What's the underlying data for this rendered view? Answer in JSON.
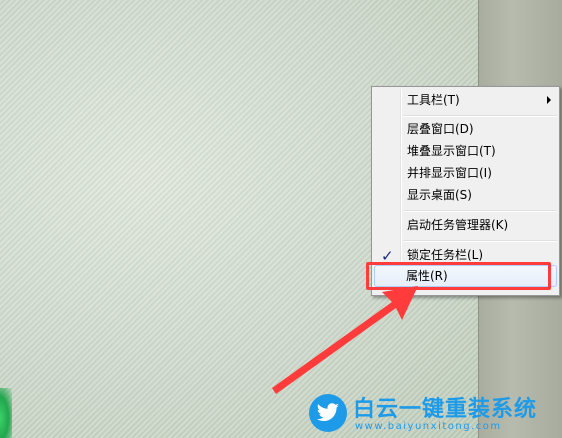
{
  "context_menu": {
    "items": [
      {
        "label": "工具栏(T)",
        "has_submenu": true
      },
      {
        "label": "层叠窗口(D)"
      },
      {
        "label": "堆叠显示窗口(T)"
      },
      {
        "label": "并排显示窗口(I)"
      },
      {
        "label": "显示桌面(S)"
      },
      {
        "label": "启动任务管理器(K)"
      },
      {
        "label": "锁定任务栏(L)",
        "checked": true
      },
      {
        "label": "属性(R)",
        "highlighted": true
      }
    ]
  },
  "annotation": {
    "highlight_color": "#ff3b3b",
    "target_item": "属性(R)"
  },
  "watermark": {
    "title": "白云一键重装系统",
    "url": "www.baiyunxitong.com",
    "color": "#1e9be8",
    "logo_icon": "twitter-bird-icon"
  }
}
